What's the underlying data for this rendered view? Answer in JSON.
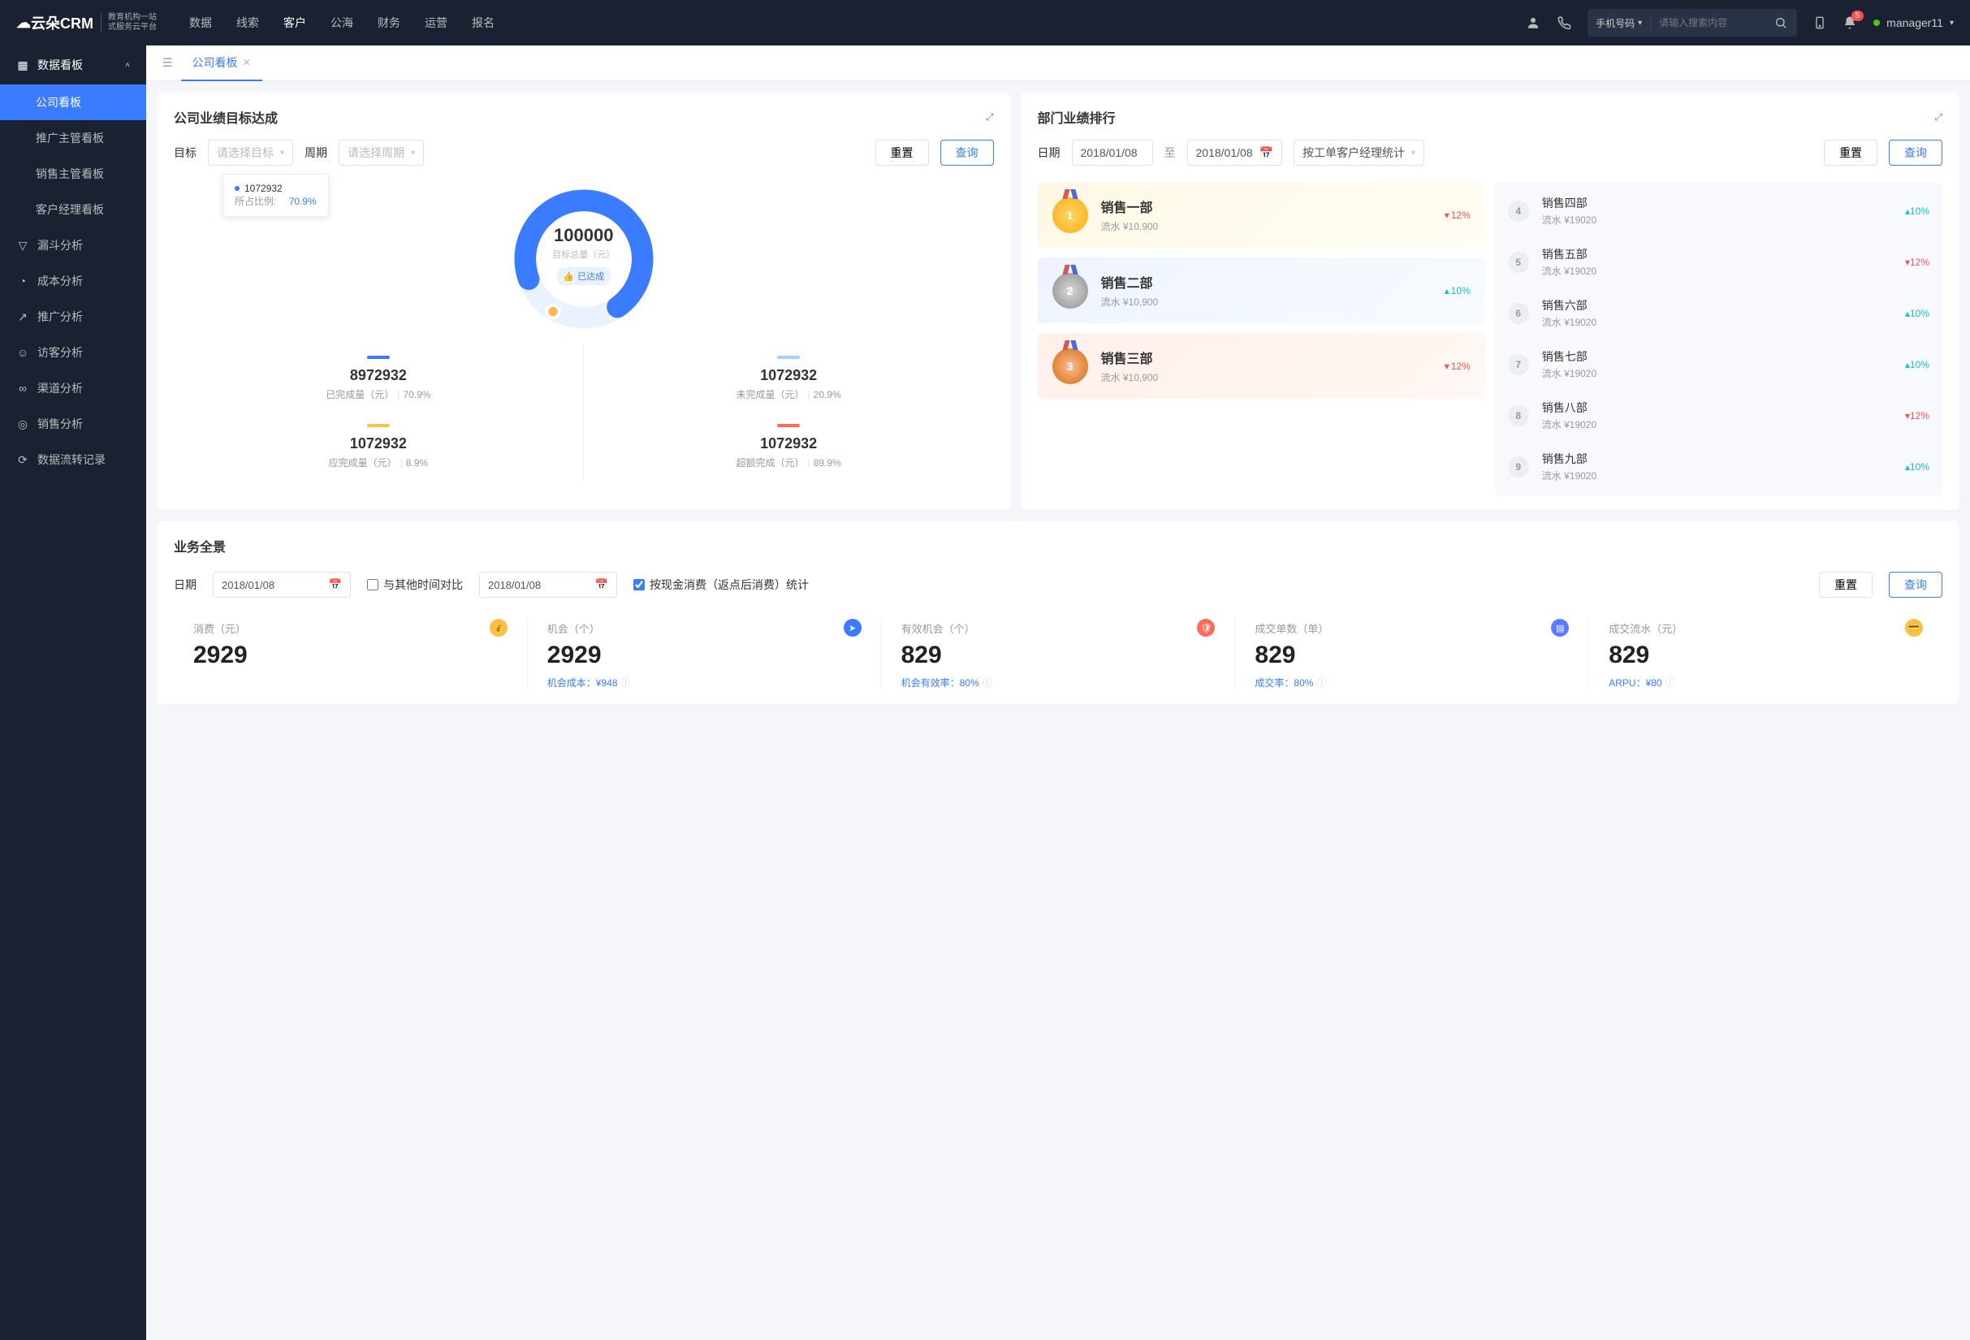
{
  "topnav": {
    "logo_main": "云朵CRM",
    "logo_sub1": "教育机构一站",
    "logo_sub2": "式服务云平台",
    "items": [
      "数据",
      "线索",
      "客户",
      "公海",
      "财务",
      "运营",
      "报名"
    ],
    "active_index": 2,
    "search_type": "手机号码",
    "search_placeholder": "请输入搜索内容",
    "notif_count": "5",
    "username": "manager11"
  },
  "sidebar": {
    "group_title": "数据看板",
    "group_items": [
      "公司看板",
      "推广主管看板",
      "销售主管看板",
      "客户经理看板"
    ],
    "group_active": 0,
    "items": [
      "漏斗分析",
      "成本分析",
      "推广分析",
      "访客分析",
      "渠道分析",
      "销售分析",
      "数据流转记录"
    ]
  },
  "tabs": {
    "current": "公司看板"
  },
  "card_goal": {
    "title": "公司业绩目标达成",
    "label_target": "目标",
    "target_placeholder": "请选择目标",
    "label_period": "周期",
    "period_placeholder": "请选择周期",
    "btn_reset": "重置",
    "btn_query": "查询",
    "tooltip_value": "1072932",
    "tooltip_label": "所占比例:",
    "tooltip_pct": "70.9%",
    "center_value": "100000",
    "center_label": "目标总量（元）",
    "center_badge": "已达成",
    "stats": [
      {
        "color": "#3a7bff",
        "value": "8972932",
        "label": "已完成量（元）",
        "pct": "70.9%"
      },
      {
        "color": "#a8d0ff",
        "value": "1072932",
        "label": "未完成量（元）",
        "pct": "20.9%"
      },
      {
        "color": "#ffbf47",
        "value": "1072932",
        "label": "应完成量（元）",
        "pct": "8.9%"
      },
      {
        "color": "#ff6b5b",
        "value": "1072932",
        "label": "超额完成（元）",
        "pct": "89.9%"
      }
    ]
  },
  "card_rank": {
    "title": "部门业绩排行",
    "label_date": "日期",
    "date_from": "2018/01/08",
    "date_sep": "至",
    "date_to": "2018/01/08",
    "sort_select": "按工单客户经理统计",
    "btn_reset": "重置",
    "btn_query": "查询",
    "top3": [
      {
        "name": "销售一部",
        "sub": "流水 ¥10,900",
        "pct": "12%",
        "dir": "down"
      },
      {
        "name": "销售二部",
        "sub": "流水 ¥10,900",
        "pct": "10%",
        "dir": "up"
      },
      {
        "name": "销售三部",
        "sub": "流水 ¥10,900",
        "pct": "12%",
        "dir": "down"
      }
    ],
    "rest": [
      {
        "n": "4",
        "name": "销售四部",
        "sub": "流水 ¥19020",
        "pct": "10%",
        "dir": "up"
      },
      {
        "n": "5",
        "name": "销售五部",
        "sub": "流水 ¥19020",
        "pct": "12%",
        "dir": "down"
      },
      {
        "n": "6",
        "name": "销售六部",
        "sub": "流水 ¥19020",
        "pct": "10%",
        "dir": "up"
      },
      {
        "n": "7",
        "name": "销售七部",
        "sub": "流水 ¥19020",
        "pct": "10%",
        "dir": "up"
      },
      {
        "n": "8",
        "name": "销售八部",
        "sub": "流水 ¥19020",
        "pct": "12%",
        "dir": "down"
      },
      {
        "n": "9",
        "name": "销售九部",
        "sub": "流水 ¥19020",
        "pct": "10%",
        "dir": "up"
      }
    ]
  },
  "card_overview": {
    "title": "业务全景",
    "label_date": "日期",
    "date1": "2018/01/08",
    "compare_label": "与其他时间对比",
    "date2": "2018/01/08",
    "check_label": "按现金消费（返点后消费）统计",
    "btn_reset": "重置",
    "btn_query": "查询",
    "metrics": [
      {
        "title": "消费（元）",
        "value": "2929",
        "sub": "",
        "icon_bg": "#ffbf47"
      },
      {
        "title": "机会（个）",
        "value": "2929",
        "sub": "机会成本：¥948",
        "icon_bg": "#3a7bff"
      },
      {
        "title": "有效机会（个）",
        "value": "829",
        "sub": "机会有效率：80%",
        "icon_bg": "#ff6b5b"
      },
      {
        "title": "成交单数（单）",
        "value": "829",
        "sub": "成交率：80%",
        "icon_bg": "#5b7cff"
      },
      {
        "title": "成交流水（元）",
        "value": "829",
        "sub": "ARPU：¥80",
        "icon_bg": "#ffbf47"
      }
    ]
  },
  "chart_data": {
    "type": "pie",
    "title": "公司业绩目标达成",
    "total_label": "目标总量（元）",
    "total": 100000,
    "series": [
      {
        "name": "已完成量（元）",
        "value": 8972932,
        "pct": 70.9,
        "color": "#3a7bff"
      },
      {
        "name": "未完成量（元）",
        "value": 1072932,
        "pct": 20.9,
        "color": "#a8d0ff"
      },
      {
        "name": "应完成量（元）",
        "value": 1072932,
        "pct": 8.9,
        "color": "#ffbf47"
      },
      {
        "name": "超额完成（元）",
        "value": 1072932,
        "pct": 89.9,
        "color": "#ff6b5b"
      }
    ],
    "tooltip": {
      "value": 1072932,
      "ratio": 70.9
    }
  }
}
